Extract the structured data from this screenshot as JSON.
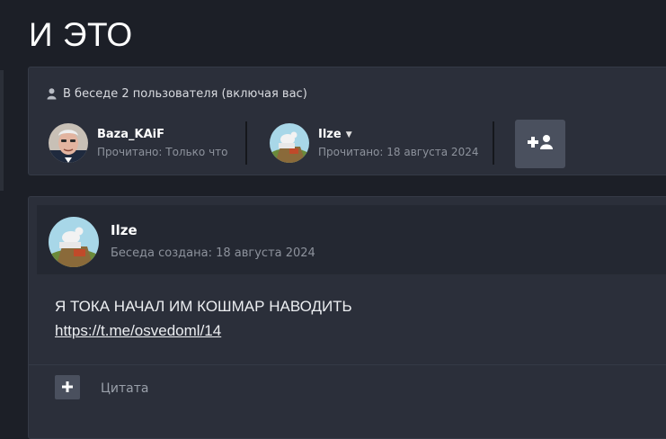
{
  "page": {
    "title": "И ЭТО"
  },
  "participants": {
    "header": "В беседе 2 пользователя (включая вас)",
    "icon": "user-icon",
    "members": [
      {
        "name": "Baza_KAiF",
        "read_status": "Прочитано: Только что",
        "has_menu": false
      },
      {
        "name": "Ilze",
        "read_status": "Прочитано: 18 августа 2024",
        "has_menu": true
      }
    ],
    "invite_icon": "add-user-icon"
  },
  "message": {
    "author": "Ilze",
    "created": "Беседа создана: 18 августа 2024",
    "text": "Я ТОКА НАЧАЛ ИМ КОШМАР НАВОДИТЬ",
    "link": "https://t.me/osvedoml/14",
    "quote_label": "Цитата",
    "quote_icon": "plus-icon"
  },
  "colors": {
    "background": "#1c1f27",
    "card": "#2b2f3a",
    "header_strip": "#242832",
    "button": "#4a505e",
    "muted_text": "#8d929c"
  }
}
